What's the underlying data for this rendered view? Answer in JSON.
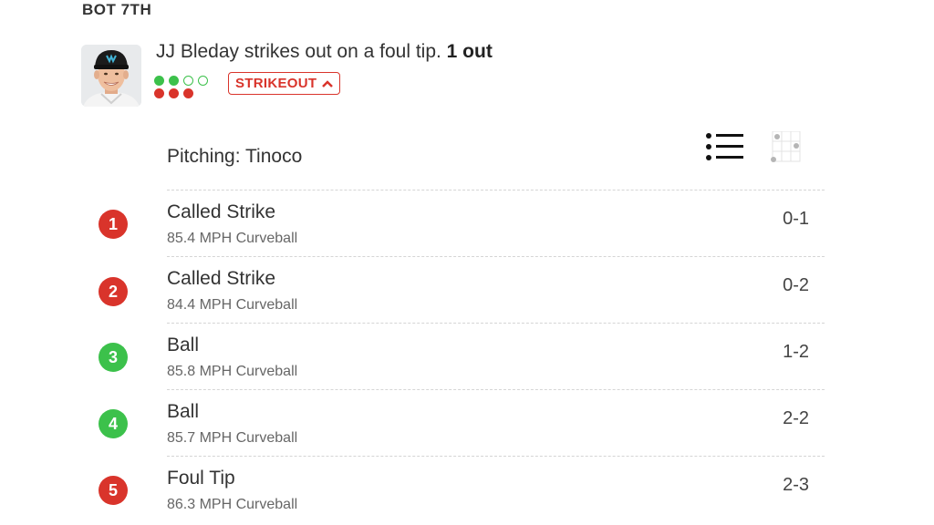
{
  "header": {
    "inning": "BOT 7TH"
  },
  "play": {
    "description": "JJ Bleday strikes out on a foul tip.",
    "outs": "1 out",
    "result_badge": "STRIKEOUT",
    "balls_indicator": 2,
    "strikes_indicator": 3
  },
  "pitching": {
    "label": "Pitching: Tinoco"
  },
  "colors": {
    "strike": "#d9342b",
    "ball": "#3cc14b"
  },
  "pitches": [
    {
      "number": "1",
      "result": "Called Strike",
      "detail": "85.4 MPH Curveball",
      "count": "0-1",
      "type": "strike"
    },
    {
      "number": "2",
      "result": "Called Strike",
      "detail": "84.4 MPH Curveball",
      "count": "0-2",
      "type": "strike"
    },
    {
      "number": "3",
      "result": "Ball",
      "detail": "85.8 MPH Curveball",
      "count": "1-2",
      "type": "ball"
    },
    {
      "number": "4",
      "result": "Ball",
      "detail": "85.7 MPH Curveball",
      "count": "2-2",
      "type": "ball"
    },
    {
      "number": "5",
      "result": "Foul Tip",
      "detail": "86.3 MPH Curveball",
      "count": "2-3",
      "type": "strike"
    }
  ],
  "icons": {
    "list_view": "list-icon",
    "grid_view": "strike-zone-grid-icon",
    "badge_toggle": "chevron-up-icon"
  }
}
